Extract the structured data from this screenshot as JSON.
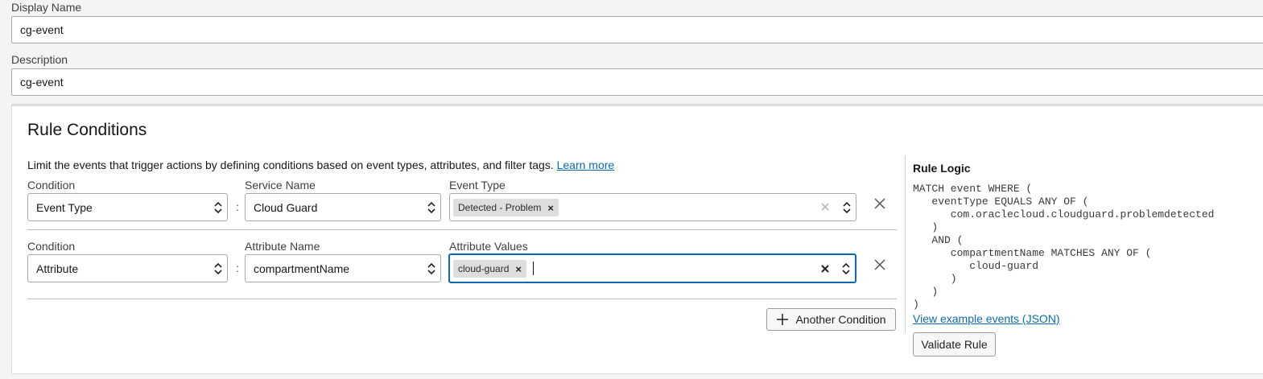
{
  "display_name": {
    "label": "Display Name",
    "value": "cg-event"
  },
  "description": {
    "label": "Description",
    "value": "cg-event"
  },
  "rule_conditions": {
    "title": "Rule Conditions",
    "description": "Limit the events that trigger actions by defining conditions based on event types, attributes, and filter tags.",
    "learn_more": "Learn more",
    "rows": [
      {
        "condition_label": "Condition",
        "condition_value": "Event Type",
        "colon": ":",
        "field_label": "Service Name",
        "field_value": "Cloud Guard",
        "values_label": "Event Type",
        "chip": "Detected - Problem"
      },
      {
        "condition_label": "Condition",
        "condition_value": "Attribute",
        "colon": ":",
        "field_label": "Attribute Name",
        "field_value": "compartmentName",
        "values_label": "Attribute Values",
        "chip": "cloud-guard"
      }
    ],
    "another_condition": "Another Condition"
  },
  "rule_logic": {
    "title": "Rule Logic",
    "code": "MATCH event WHERE (\n   eventType EQUALS ANY OF (\n      com.oraclecloud.cloudguard.problemdetected\n   )\n   AND (\n      compartmentName MATCHES ANY OF (\n         cloud-guard\n      )\n   )\n)",
    "example_link": "View example events (JSON)",
    "validate": "Validate Rule"
  },
  "colors": {
    "focus": "#0b6ab3",
    "link": "#0b6ab3",
    "chip": "#dedede"
  }
}
